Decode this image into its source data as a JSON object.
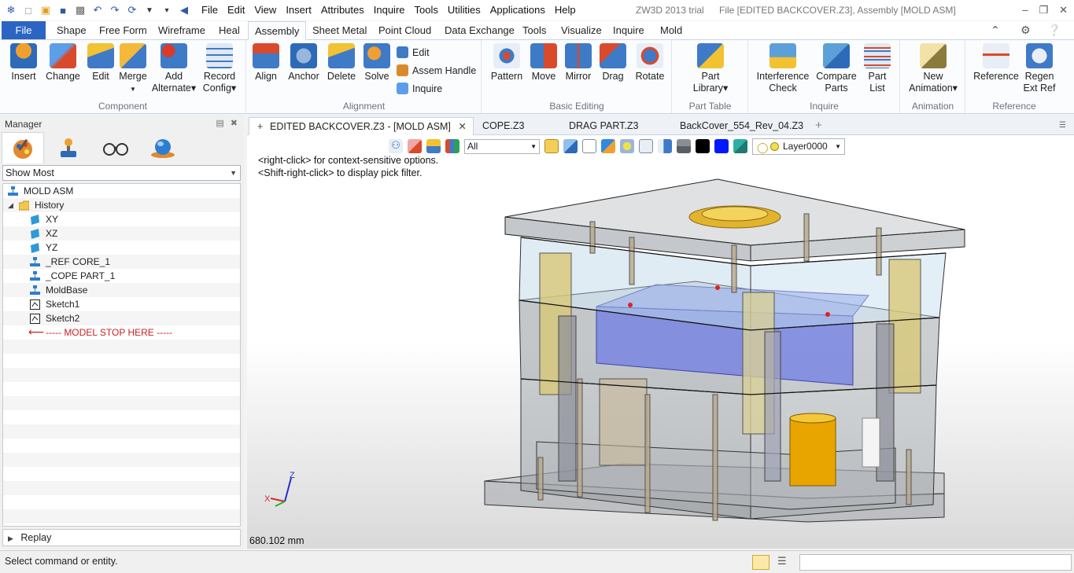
{
  "titlebar": {
    "app": "ZW3D 2013 trial",
    "file": "File [EDITED BACKCOVER.Z3],  Assembly [MOLD ASM]",
    "menus": [
      "File",
      "Edit",
      "View",
      "Insert",
      "Attributes",
      "Inquire",
      "Tools",
      "Utilities",
      "Applications",
      "Help"
    ]
  },
  "ribbon_tabs": {
    "file": "File",
    "tabs": [
      "Shape",
      "Free Form",
      "Wireframe",
      "Heal",
      "Assembly",
      "Sheet Metal",
      "Point Cloud",
      "Data Exchange",
      "Tools",
      "Visualize",
      "Inquire",
      "Mold"
    ],
    "active": "Assembly"
  },
  "ribbon": {
    "component": {
      "label": "Component",
      "insert": "Insert",
      "change": "Change",
      "edit": "Edit",
      "merge": "Merge",
      "add_alternate_1": "Add",
      "add_alternate_2": "Alternate",
      "record_config_1": "Record",
      "record_config_2": "Config"
    },
    "alignment": {
      "label": "Alignment",
      "align": "Align",
      "anchor": "Anchor",
      "delete": "Delete",
      "solve": "Solve",
      "edit": "Edit",
      "assem_handle": "Assem Handle",
      "inquire": "Inquire"
    },
    "basic_editing": {
      "label": "Basic Editing",
      "pattern": "Pattern",
      "move": "Move",
      "mirror": "Mirror",
      "drag": "Drag",
      "rotate": "Rotate"
    },
    "part_table": {
      "label": "Part Table",
      "part_library_1": "Part",
      "part_library_2": "Library"
    },
    "inquire": {
      "label": "Inquire",
      "interference_1": "Interference",
      "interference_2": "Check",
      "compare_1": "Compare",
      "compare_2": "Parts",
      "partlist_1": "Part",
      "partlist_2": "List"
    },
    "animation": {
      "label": "Animation",
      "new_1": "New",
      "new_2": "Animation"
    },
    "reference": {
      "label": "Reference",
      "reference": "Reference",
      "regen_1": "Regen",
      "regen_2": "Ext Ref"
    }
  },
  "manager": {
    "title": "Manager",
    "filter": "Show Most",
    "tree": {
      "root": "MOLD ASM",
      "history": "History",
      "xy": "XY",
      "xz": "XZ",
      "yz": "YZ",
      "ref_core": "_REF CORE_1",
      "cope_part": "_COPE PART_1",
      "moldbase": "MoldBase",
      "sketch1": "Sketch1",
      "sketch2": "Sketch2",
      "stop": "----- MODEL STOP HERE -----"
    },
    "replay": "Replay"
  },
  "doc_tabs": {
    "active": "EDITED BACKCOVER.Z3 - [MOLD ASM]",
    "tab2": "COPE.Z3",
    "tab3": "DRAG PART.Z3",
    "tab4": "BackCover_554_Rev_04.Z3"
  },
  "viewport": {
    "pick_filter": "All",
    "layer": "Layer0000",
    "hint1": "<right-click> for context-sensitive options.",
    "hint2": "<Shift-right-click> to display pick filter.",
    "scale": "680.102 mm",
    "axis_x": "X",
    "axis_z": "Z"
  },
  "status": {
    "text": "Select command or entity."
  },
  "colors": {
    "accent": "#2b64c3",
    "stop_red": "#cc1f1f",
    "mold_plate": "#8f9499",
    "pins_yellow": "#e0c44a"
  }
}
